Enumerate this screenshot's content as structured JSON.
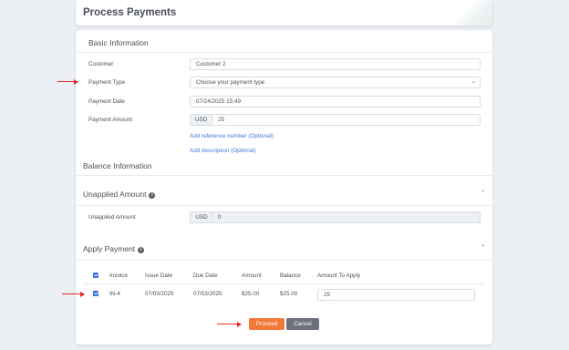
{
  "page": {
    "title": "Process Payments"
  },
  "basic_info": {
    "heading": "Basic Information",
    "customer": {
      "label": "Customer",
      "value": "Customer 2"
    },
    "payment_type": {
      "label": "Payment Type",
      "placeholder": "Choose your payment type"
    },
    "payment_date": {
      "label": "Payment Date",
      "value": "07/24/2025 15:49"
    },
    "payment_amount": {
      "label": "Payment Amount",
      "currency": "USD",
      "value": "25"
    },
    "add_reference": "Add reference number (Optional)",
    "add_description": "Add description (Optional)"
  },
  "balance_info": {
    "heading": "Balance Information"
  },
  "unapplied": {
    "heading": "Unapplied Amount",
    "label": "Unapplied Amount",
    "currency": "USD",
    "value": "0"
  },
  "apply_payment": {
    "heading": "Apply Payment",
    "columns": [
      "Invoice",
      "Issue Date",
      "Due Date",
      "Amount",
      "Balance",
      "Amount To Apply"
    ],
    "rows": [
      {
        "invoice": "IN-4",
        "issue_date": "07/03/2025",
        "due_date": "07/03/2025",
        "amount": "$25.00",
        "balance": "$25.00",
        "amount_to_apply": "25"
      }
    ]
  },
  "actions": {
    "proceed": "Proceed",
    "cancel": "Cancel"
  },
  "colors": {
    "accent": "#f2793a",
    "link": "#3d7bd9",
    "checkbox": "#2f6de1",
    "annotation_arrow": "#e52b2b"
  }
}
